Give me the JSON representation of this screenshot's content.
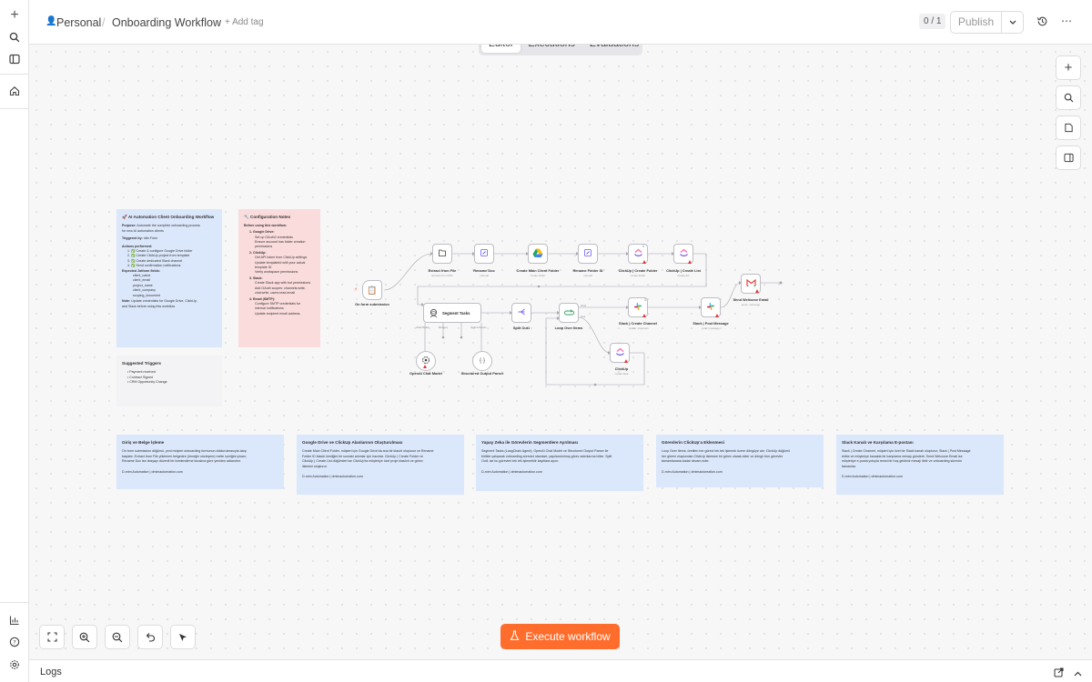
{
  "header": {
    "workspace": "Personal",
    "workflow_name": "Onboarding Workflow",
    "add_tag": "+ Add tag",
    "version_counter": "0 / 1",
    "publish_label": "Publish"
  },
  "tabs": [
    {
      "label": "Editor",
      "active": true
    },
    {
      "label": "Executions",
      "active": false
    },
    {
      "label": "Evaluations",
      "active": false
    }
  ],
  "colors": {
    "accent": "#ff6d2d",
    "sticky_blue": "#dbe7fb",
    "sticky_pink": "#fbdcdc",
    "warning": "#e0363a"
  },
  "stickies": {
    "overview": {
      "title": "🚀 AI Automation Client Onboarding Workflow",
      "purpose_label": "Purpose:",
      "purpose_1": "Automate the complete onboarding process",
      "purpose_2": "for new AI automation clients",
      "trigger_label": "Triggered by:",
      "trigger_value": "n8n Form",
      "actions_label": "Actions performed:",
      "actions": [
        "1. ✅ Create & configure Google Drive folder",
        "2. ✅ Create ClickUp project from template",
        "3. ✅ Create dedicated Slack channel",
        "4. ✅ Send confirmation notifications"
      ],
      "fields_label": "Expected Jotform fields:",
      "fields": [
        "client_name",
        "client_email",
        "project_name",
        "client_company",
        "scoping_document"
      ],
      "note_label": "Note:",
      "note_text": "Update credentials for Google Drive, ClickUp,",
      "note_text_2": "and Slack before using this workflow"
    },
    "config": {
      "title": "🔧 Configuration Notes",
      "intro": "Before using this workflow:",
      "sections": [
        {
          "head": "1. Google Drive:",
          "items": [
            "Set up OAuth2 credentials",
            "Ensure account has folder creation",
            "permissions"
          ]
        },
        {
          "head": "2. ClickUp:",
          "items": [
            "Get API token from ClickUp settings",
            "Update templateId with your actual",
            "template ID",
            "Verify workspace permissions"
          ]
        },
        {
          "head": "3. Slack:",
          "items": [
            "Create Slack app with bot permissions",
            "Add OAuth scopes: channels:write,",
            "chat:write, users:read.email"
          ]
        },
        {
          "head": "4. Email (SMTP):",
          "items": [
            "Configure SMTP credentials for",
            "internal notifications",
            "Update recipient email address"
          ]
        }
      ]
    },
    "triggers": {
      "title": "Suggested Triggers",
      "items": [
        "• Payment received",
        "• Contract Signed",
        "• CRM Opportunity Change"
      ]
    },
    "bottom": [
      {
        "title": "Giriş ve Belge İşleme",
        "lines": [
          "On form submission düğümü, yeni müşteri onboarding formunun doldurulmasıyla akışı",
          "başlatır. Extract from File yüklenen belgeden (örneğin sözleşme) metin içeriğini çıkarır,",
          "Rename Doc ise dosyayı düzenli bir isimlendirme kuralına göre yeniden adlandırır."
        ],
        "footer": "D-mim Automation | dmimautomation.com"
      },
      {
        "title": "Google Drive ve ClickUp Alanlarının Oluşturulması",
        "lines": [
          "Create Main Client Folder, müşteri için Google Drive'da ana bir klasör oluşturur ve Rename",
          "Folder ID klasör kimliğini bir sonraki adımlar için hazırlar. ClickUp | Create Folder ve",
          "ClickUp | Create List düğümleri ise ClickUp'ta müşteriye özel proje klasörü ve görev",
          "listesini oluşturur."
        ],
        "footer": "D-mim Automation | dmimautomation.com"
      },
      {
        "title": "Yapay Zeka ile Görevlerin Segmentlere Ayrılması",
        "lines": [
          "Segment Tasks (LangChain Agent), OpenAI Chat Model ve Structured Output Parser ile",
          "birlikte çalışarak onboarding sürecini standart, yapılandırılmış görev adımlarına böler. Split",
          "Out1 ise bu görevleri tek tek işlenebilir kayıtlara ayırır."
        ],
        "footer": "D-mim Automation | dmimautomation.com"
      },
      {
        "title": "Görevlerin ClickUp'a Eklenmesi",
        "lines": [
          "Loop Over Items, üretilen her görevi tek tek işlemek üzere döngüye alır; ClickUp düğümü",
          "her görevi oluşturulan ClickUp listesine bir görev olarak ekler ve döngü tüm görevler",
          "tamamlanana kadar devam eder."
        ],
        "footer": "D-mim Automation | dmimautomation.com"
      },
      {
        "title": "Slack Kanalı ve Karşılama E-postası",
        "lines": [
          "Slack | Create Channel, müşteri için özel bir Slack kanalı oluşturur; Slack | Post Message",
          "ekibe ve müşteriye kanalda bir karşılama mesajı gönderir. Send Welcome Email ise",
          "müşteriye e-posta yoluyla resmi bir hoş geldiniz mesajı iletir ve onboarding sürecini",
          "tamamlar."
        ],
        "footer": "D-mim Automation | dmimautomation.com"
      }
    ]
  },
  "nodes": {
    "form": {
      "label": "On form submission",
      "icon": "clipboard-icon"
    },
    "extract": {
      "label": "Extract from File",
      "sub": "Extract from PDF",
      "icon": "file-icon"
    },
    "rename_doc": {
      "label": "Rename Doc",
      "sub": "manual",
      "icon": "pencil-icon"
    },
    "drive": {
      "label": "Create Main Client Folder",
      "sub": "create folder",
      "icon": "google-drive-icon"
    },
    "rename_folder": {
      "label": "Rename Folder ID",
      "sub": "manual",
      "icon": "pencil-icon"
    },
    "cu_folder": {
      "label": "ClickUp | Create Folder",
      "sub": "create:folder",
      "icon": "clickup-icon",
      "badge": "1"
    },
    "cu_list": {
      "label": "ClickUp | Create List",
      "sub": "create:list",
      "icon": "clickup-icon"
    },
    "email": {
      "label": "Send Welcome Email",
      "sub": "send: message",
      "icon": "gmail-icon"
    },
    "segment": {
      "label": "Segment Tasks",
      "icon": "agent-icon",
      "ports": [
        "Chat Model",
        "Memory",
        "Output Parser"
      ]
    },
    "openai": {
      "label": "OpenAI Chat Model",
      "icon": "openai-icon"
    },
    "parser": {
      "label": "Structured Output Parser",
      "icon": "braces-icon"
    },
    "split": {
      "label": "Split Out1",
      "icon": "split-icon"
    },
    "loop": {
      "label": "Loop Over Items",
      "icon": "loop-icon",
      "out_done": "done",
      "out_loop": "loop"
    },
    "slack_channel": {
      "label": "Slack | Create Channel",
      "sub": "create: channel",
      "icon": "slack-icon",
      "badge": "1"
    },
    "slack_post": {
      "label": "Slack | Post Message",
      "sub": "post: message",
      "icon": "slack-icon"
    },
    "clickup": {
      "label": "ClickUp",
      "sub": "create:task",
      "icon": "clickup-icon"
    }
  },
  "execute_label": "Execute workflow",
  "logs_label": "Logs"
}
